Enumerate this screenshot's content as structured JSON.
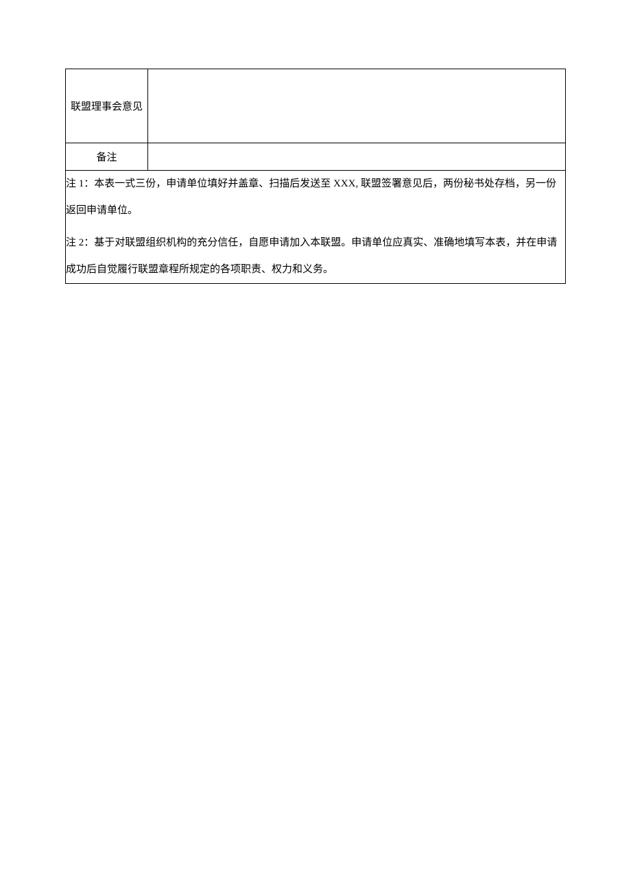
{
  "table": {
    "row1_label": "联盟理事会意见",
    "row1_value": "",
    "row2_label": "备注",
    "row2_value": "",
    "note1": "注 1：本表一式三份，申请单位填好并盖章、扫描后发送至 XXX, 联盟签署意见后，两份秘书处存档，另一份返回申请单位。",
    "note2": "注 2：基于对联盟组织机构的充分信任，自愿申请加入本联盟。申请单位应真实、准确地填写本表，并在申请成功后自觉履行联盟章程所规定的各项职责、权力和义务。"
  }
}
